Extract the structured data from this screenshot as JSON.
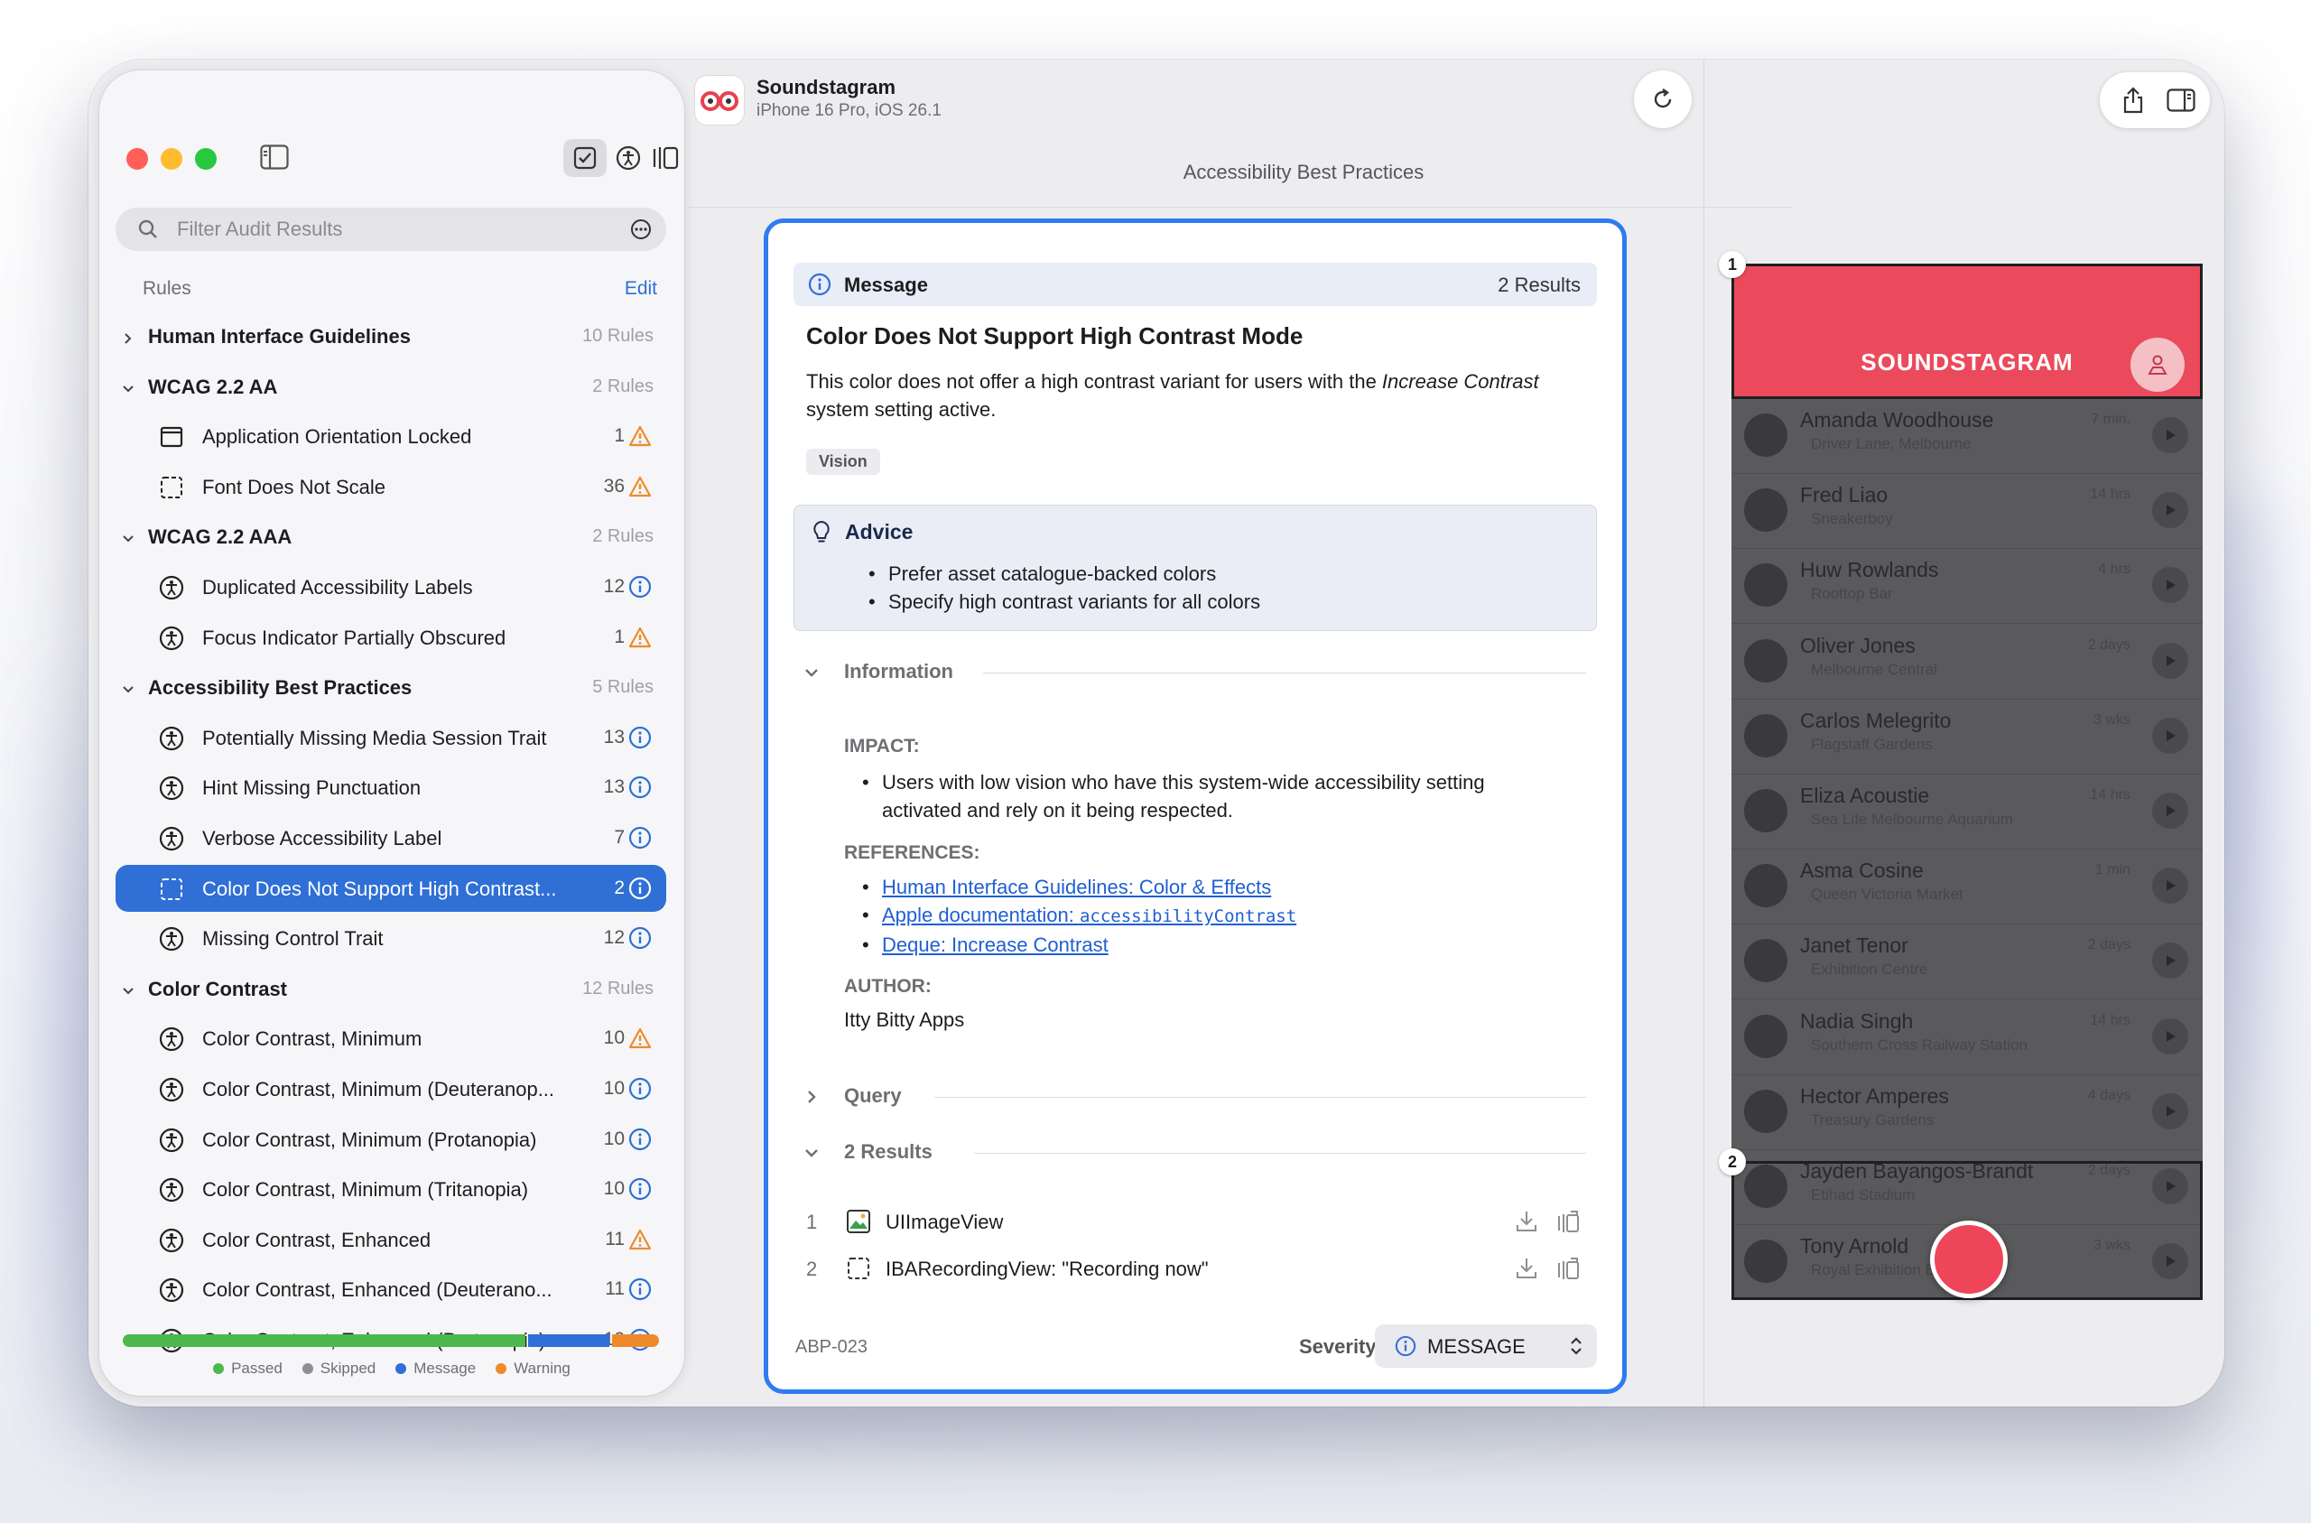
{
  "sidebar": {
    "search_placeholder": "Filter Audit Results",
    "rules_header": "Rules",
    "edit_label": "Edit",
    "groups": [
      {
        "title": "Human Interface Guidelines",
        "count": "10 Rules",
        "expanded": false,
        "items": []
      },
      {
        "title": "WCAG 2.2 AA",
        "count": "2 Rules",
        "expanded": true,
        "items": [
          {
            "label": "Application Orientation Locked",
            "count": "1",
            "severity": "warning",
            "icon": "window-icon"
          },
          {
            "label": "Font Does Not Scale",
            "count": "36",
            "severity": "warning",
            "icon": "dashed-box-icon"
          }
        ]
      },
      {
        "title": "WCAG 2.2 AAA",
        "count": "2 Rules",
        "expanded": true,
        "items": [
          {
            "label": "Duplicated Accessibility Labels",
            "count": "12",
            "severity": "message",
            "icon": "accessibility-icon"
          },
          {
            "label": "Focus Indicator Partially Obscured",
            "count": "1",
            "severity": "warning",
            "icon": "accessibility-icon"
          }
        ]
      },
      {
        "title": "Accessibility Best Practices",
        "count": "5 Rules",
        "expanded": true,
        "items": [
          {
            "label": "Potentially Missing Media Session Trait",
            "count": "13",
            "severity": "message",
            "icon": "accessibility-icon"
          },
          {
            "label": "Hint Missing Punctuation",
            "count": "13",
            "severity": "message",
            "icon": "accessibility-icon"
          },
          {
            "label": "Verbose Accessibility Label",
            "count": "7",
            "severity": "message",
            "icon": "accessibility-icon"
          },
          {
            "label": "Color Does Not Support High Contrast...",
            "count": "2",
            "severity": "message",
            "icon": "dashed-box-icon",
            "selected": true
          },
          {
            "label": "Missing Control Trait",
            "count": "12",
            "severity": "message",
            "icon": "accessibility-icon"
          }
        ]
      },
      {
        "title": "Color Contrast",
        "count": "12 Rules",
        "expanded": true,
        "items": [
          {
            "label": "Color Contrast, Minimum",
            "count": "10",
            "severity": "warning",
            "icon": "accessibility-icon"
          },
          {
            "label": "Color Contrast, Minimum (Deuteranop...",
            "count": "10",
            "severity": "message",
            "icon": "accessibility-icon"
          },
          {
            "label": "Color Contrast, Minimum (Protanopia)",
            "count": "10",
            "severity": "message",
            "icon": "accessibility-icon"
          },
          {
            "label": "Color Contrast, Minimum (Tritanopia)",
            "count": "10",
            "severity": "message",
            "icon": "accessibility-icon"
          },
          {
            "label": "Color Contrast, Enhanced",
            "count": "11",
            "severity": "warning",
            "icon": "accessibility-icon"
          },
          {
            "label": "Color Contrast, Enhanced (Deuterano...",
            "count": "11",
            "severity": "message",
            "icon": "accessibility-icon"
          },
          {
            "label": "Color Contrast, Enhanced (Protanopia)",
            "count": "10",
            "severity": "message",
            "icon": "accessibility-icon"
          }
        ]
      }
    ],
    "summary": {
      "segments": [
        {
          "name": "Passed",
          "fraction": 0.47,
          "color": "#4cb84f"
        },
        {
          "name": "Skipped",
          "fraction": 0.0,
          "color": "#8e8e93"
        },
        {
          "name": "Message",
          "fraction": 0.095,
          "color": "#2f6fd6"
        },
        {
          "name": "Warning",
          "fraction": 0.055,
          "color": "#ef8a2c"
        }
      ],
      "legend": [
        "Passed",
        "Skipped",
        "Message",
        "Warning"
      ]
    }
  },
  "header": {
    "app_name": "Soundstagram",
    "device": "iPhone 16 Pro, iOS 26.1",
    "section_title": "Accessibility Best Practices"
  },
  "detail": {
    "type_label": "Message",
    "result_count": "2 Results",
    "title": "Color Does Not Support High Contrast Mode",
    "description_pre": "This color does not offer a high contrast variant for users with the ",
    "description_em": "Increase Contrast",
    "description_post": " system setting active.",
    "tag": "Vision",
    "advice_title": "Advice",
    "advice": [
      "Prefer asset catalogue-backed colors",
      "Specify high contrast variants for all colors"
    ],
    "information_label": "Information",
    "impact_label": "IMPACT:",
    "impact": "Users with low vision who have this system-wide accessibility setting activated and rely on it being respected.",
    "references_label": "REFERENCES:",
    "ref1": "Human Interface Guidelines: Color & Effects",
    "ref2_pre": "Apple documentation: ",
    "ref2_code": "accessibilityContrast",
    "ref3": "Deque: Increase Contrast",
    "author_label": "AUTHOR:",
    "author": "Itty Bitty Apps",
    "query_label": "Query",
    "results_label": "2 Results",
    "results": [
      {
        "num": "1",
        "name": "UIImageView"
      },
      {
        "num": "2",
        "name": "IBARecordingView: \"Recording now\""
      }
    ],
    "rule_id": "ABP-023",
    "severity_label": "Severity",
    "severity_value": "MESSAGE"
  },
  "preview": {
    "brand": "SOUNDSTAGRAM",
    "badge1": "1",
    "badge2": "2",
    "rows": [
      {
        "name": "Amanda Woodhouse",
        "place": "Driver Lane, Melbourne",
        "time": "7 min."
      },
      {
        "name": "Fred Liao",
        "place": "Sneakerboy",
        "time": "14 hrs"
      },
      {
        "name": "Huw Rowlands",
        "place": "Rooftop Bar",
        "time": "4 hrs"
      },
      {
        "name": "Oliver Jones",
        "place": "Melbourne Central",
        "time": "2 days"
      },
      {
        "name": "Carlos Melegrito",
        "place": "Flagstaff Gardens",
        "time": "3 wks"
      },
      {
        "name": "Eliza Acoustie",
        "place": "Sea Life Melbourne Aquarium",
        "time": "14 hrs"
      },
      {
        "name": "Asma Cosine",
        "place": "Queen Victoria Market",
        "time": "1 min"
      },
      {
        "name": "Janet Tenor",
        "place": "Exhibition Centre",
        "time": "2 days"
      },
      {
        "name": "Nadia Singh",
        "place": "Southern Cross Railway Station",
        "time": "14 hrs"
      },
      {
        "name": "Hector Amperes",
        "place": "Treasury Gardens",
        "time": "4 days"
      },
      {
        "name": "Jayden Bayangos-Brandt",
        "place": "Etihad Stadium",
        "time": "2 days"
      },
      {
        "name": "Tony Arnold",
        "place": "Royal Exhibition Building",
        "time": "3 wks"
      }
    ]
  },
  "colors": {
    "accent": "#2f6fd6",
    "warning": "#ef8a2c",
    "brand_red": "#ea4a5c"
  }
}
